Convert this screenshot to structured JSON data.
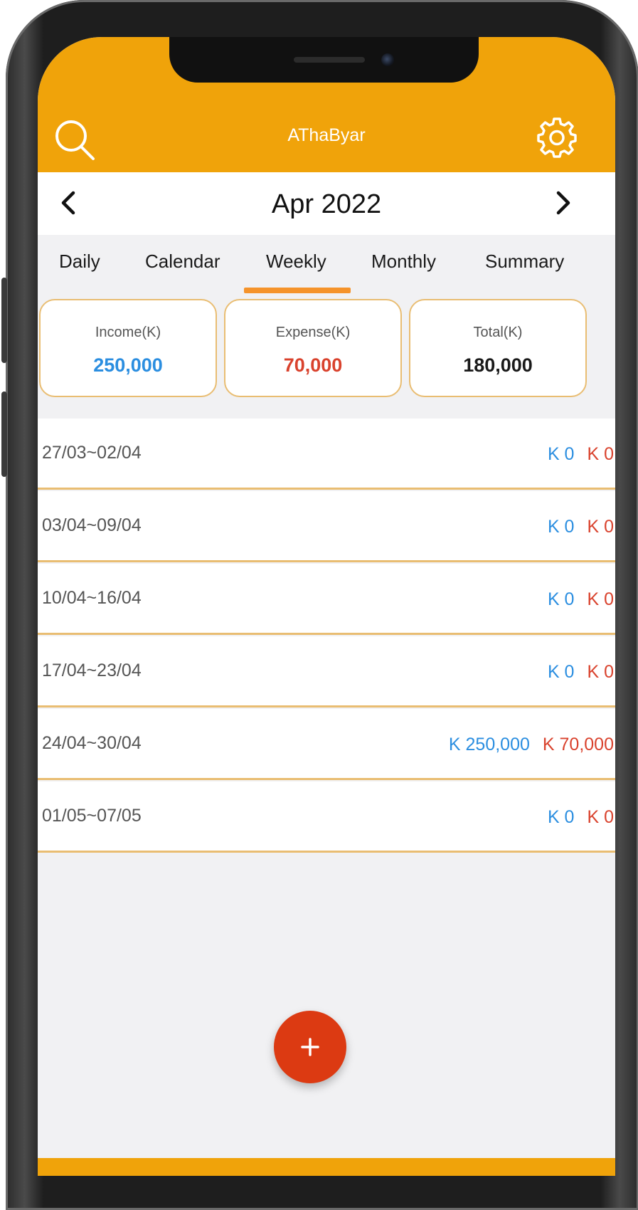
{
  "app": {
    "title": "AThaByar"
  },
  "colors": {
    "accent": "#f0a30a",
    "income": "#2b8ee0",
    "expense": "#d9422d",
    "tab_indicator": "#f5932a",
    "fab": "#dc3a12"
  },
  "header": {
    "search_icon": "search-icon",
    "settings_icon": "gear-icon"
  },
  "month_nav": {
    "label": "Apr 2022",
    "prev_icon": "chevron-left-icon",
    "next_icon": "chevron-right-icon"
  },
  "tabs": [
    {
      "label": "Daily",
      "active": false
    },
    {
      "label": "Calendar",
      "active": false
    },
    {
      "label": "Weekly",
      "active": true
    },
    {
      "label": "Monthly",
      "active": false
    },
    {
      "label": "Summary",
      "active": false
    }
  ],
  "summary": {
    "income": {
      "label": "Income(K)",
      "value": "250,000"
    },
    "expense": {
      "label": "Expense(K)",
      "value": "70,000"
    },
    "total": {
      "label": "Total(K)",
      "value": "180,000"
    }
  },
  "weeks": [
    {
      "range": "27/03~02/04",
      "income": "K 0",
      "expense": "K 0"
    },
    {
      "range": "03/04~09/04",
      "income": "K 0",
      "expense": "K 0"
    },
    {
      "range": "10/04~16/04",
      "income": "K 0",
      "expense": "K 0"
    },
    {
      "range": "17/04~23/04",
      "income": "K 0",
      "expense": "K 0"
    },
    {
      "range": "24/04~30/04",
      "income": "K 250,000",
      "expense": "K 70,000"
    },
    {
      "range": "01/05~07/05",
      "income": "K 0",
      "expense": "K 0"
    }
  ],
  "fab": {
    "label": "+",
    "icon": "plus-icon"
  }
}
